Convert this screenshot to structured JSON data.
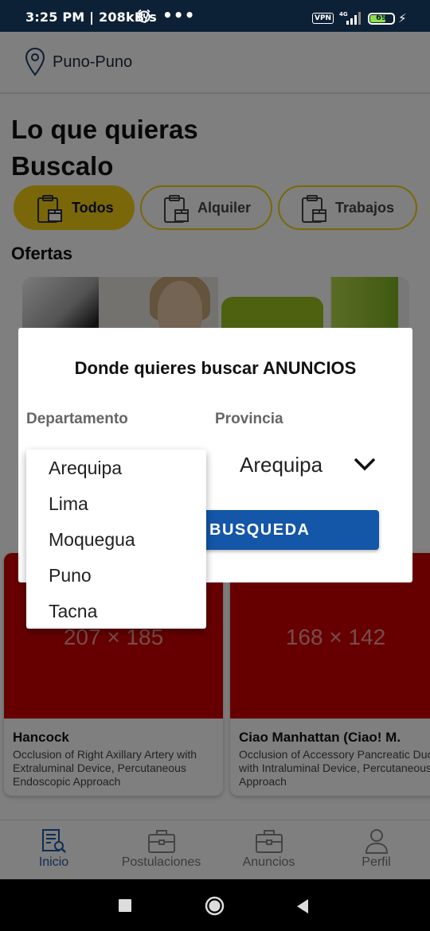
{
  "status_bar": {
    "time": "3:25 PM | 208kB/s",
    "more": "•••",
    "vpn": "VPN",
    "network": "4G",
    "battery": "69",
    "battery_level": 0.69
  },
  "location": {
    "label": "Puno-Puno"
  },
  "headline": {
    "line1": "Lo que quieras",
    "line2": "Buscalo"
  },
  "filters": [
    {
      "label": "Todos",
      "active": true
    },
    {
      "label": "Alquiler",
      "active": false
    },
    {
      "label": "Trabajos",
      "active": false
    }
  ],
  "offers": {
    "title": "Ofertas"
  },
  "cards": [
    {
      "image_placeholder": "207 × 185",
      "title": "Hancock",
      "description": "Occlusion of Right Axillary Artery with Extraluminal Device, Percutaneous Endoscopic Approach"
    },
    {
      "image_placeholder": "168 × 142",
      "title": "Ciao Manhattan (Ciao! M.",
      "description": "Occlusion of Accessory Pancreatic Duct with Intraluminal Device, Percutaneous Approach"
    }
  ],
  "bottom_nav": [
    {
      "label": "Inicio",
      "icon": "news-search-icon",
      "active": true
    },
    {
      "label": "Postulaciones",
      "icon": "briefcase-icon",
      "active": false
    },
    {
      "label": "Anuncios",
      "icon": "briefcase-icon",
      "active": false
    },
    {
      "label": "Perfil",
      "icon": "person-icon",
      "active": false
    }
  ],
  "dialog": {
    "title": "Donde quieres buscar ANUNCIOS",
    "department_label": "Departamento",
    "province_label": "Provincia",
    "province_value": "Arequipa",
    "search_button": "BUSQUEDA"
  },
  "department_options": [
    "Arequipa",
    "Lima",
    "Moquegua",
    "Puno",
    "Tacna"
  ],
  "colors": {
    "accent_yellow": "#f3cf14",
    "primary_blue": "#1456a8",
    "card_red": "#cc0000",
    "status_bar": "#0d2136"
  }
}
